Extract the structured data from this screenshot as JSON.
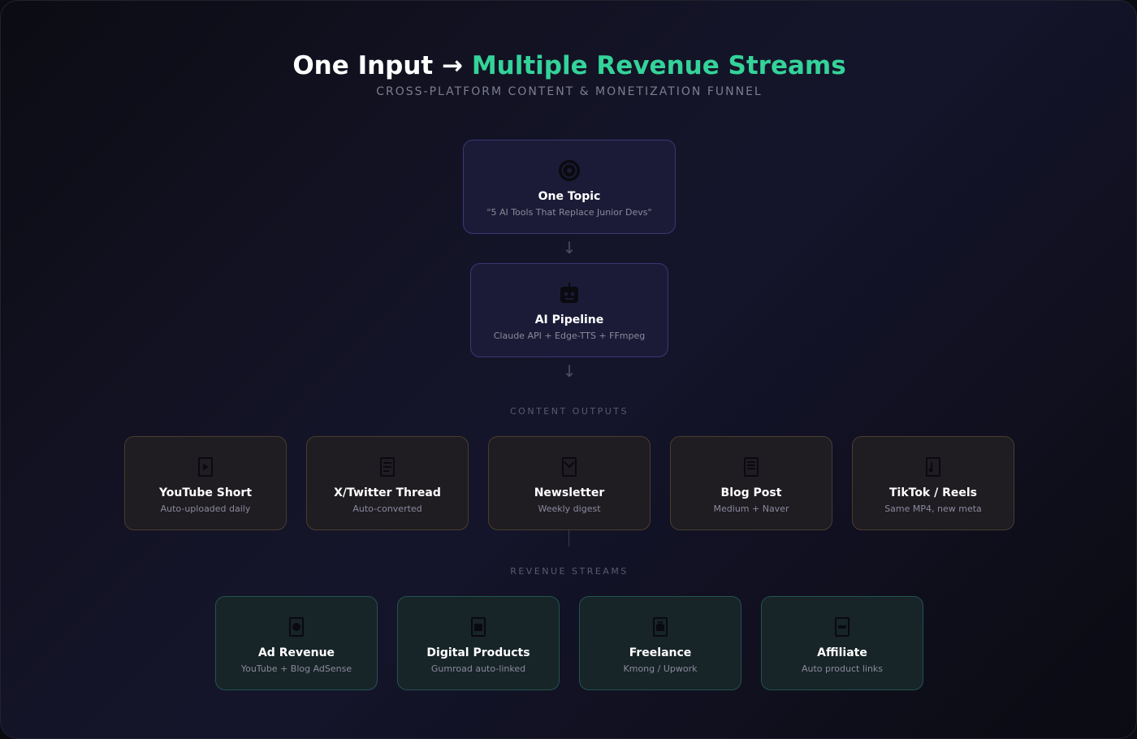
{
  "header": {
    "title_plain": "One Input → ",
    "title_accent": "Multiple Revenue Streams",
    "subtitle": "CROSS-PLATFORM CONTENT & MONETIZATION FUNNEL"
  },
  "colors": {
    "accent": "#34d399",
    "input_border": "#3a3775",
    "output_border": "#4a3d2c",
    "revenue_border": "#235350"
  },
  "pipeline": [
    {
      "icon": "target-icon",
      "name": "One Topic",
      "desc": "\"5 AI Tools That Replace Junior Devs\""
    },
    {
      "icon": "robot-icon",
      "name": "AI Pipeline",
      "desc": "Claude API + Edge-TTS + FFmpeg"
    }
  ],
  "outputs_label": "CONTENT OUTPUTS",
  "outputs": [
    {
      "icon": "video-icon",
      "name": "YouTube Short",
      "desc": "Auto-uploaded daily"
    },
    {
      "icon": "bird-icon",
      "name": "X/Twitter Thread",
      "desc": "Auto-converted"
    },
    {
      "icon": "mail-icon",
      "name": "Newsletter",
      "desc": "Weekly digest"
    },
    {
      "icon": "document-icon",
      "name": "Blog Post",
      "desc": "Medium + Naver"
    },
    {
      "icon": "phone-icon",
      "name": "TikTok / Reels",
      "desc": "Same MP4, new meta"
    }
  ],
  "revenue_label": "REVENUE STREAMS",
  "revenue": [
    {
      "icon": "money-icon",
      "name": "Ad Revenue",
      "desc": "YouTube + Blog AdSense"
    },
    {
      "icon": "package-icon",
      "name": "Digital Products",
      "desc": "Gumroad auto-linked"
    },
    {
      "icon": "briefcase-icon",
      "name": "Freelance",
      "desc": "Kmong / Upwork"
    },
    {
      "icon": "link-icon",
      "name": "Affiliate",
      "desc": "Auto product links"
    }
  ]
}
